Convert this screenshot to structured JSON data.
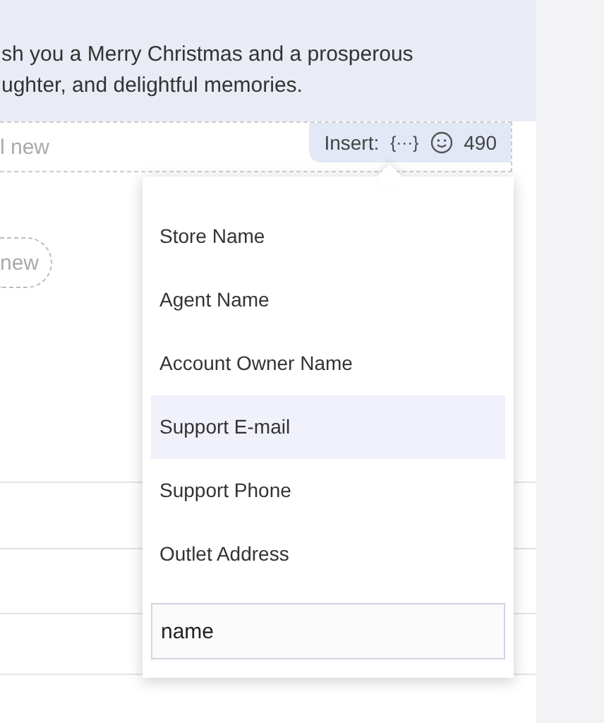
{
  "message": {
    "lines": [
      "sh you a Merry Christmas and a prosperous",
      "ughter, and delightful memories."
    ]
  },
  "new_field": {
    "placeholder": "l new"
  },
  "insert_bar": {
    "label": "Insert:",
    "variable_icon": "{···}",
    "count": "490"
  },
  "add_pill": {
    "label": "new"
  },
  "insert_menu": {
    "items": [
      {
        "label": "Store Name",
        "selected": false
      },
      {
        "label": "Agent Name",
        "selected": false
      },
      {
        "label": "Account Owner Name",
        "selected": false
      },
      {
        "label": "Support E-mail",
        "selected": true
      },
      {
        "label": "Support Phone",
        "selected": false
      },
      {
        "label": "Outlet Address",
        "selected": false
      }
    ],
    "search": {
      "value": "name"
    }
  }
}
